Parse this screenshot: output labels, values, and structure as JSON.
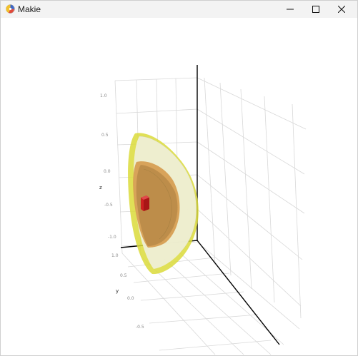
{
  "window": {
    "title": "Makie",
    "app_icon": "makie-logo-icon",
    "controls": [
      "minimize-icon",
      "maximize-icon",
      "close-icon"
    ]
  },
  "scene": {
    "z_axis": {
      "label": "z",
      "ticks": [
        "1.0",
        "0.5",
        "0.0",
        "-0.5",
        "-1.0"
      ]
    },
    "y_axis": {
      "label": "y",
      "ticks": [
        "1.0",
        "0.5",
        "0.0",
        "-0.5"
      ]
    },
    "colors": {
      "outer_shell": "#e8e8b4",
      "outer_rim": "#d8d84a",
      "middle_shell": "#d6a35a",
      "inner_core": "#d82a2a",
      "axis_line": "#000000",
      "grid": "#d6d6d6"
    }
  }
}
